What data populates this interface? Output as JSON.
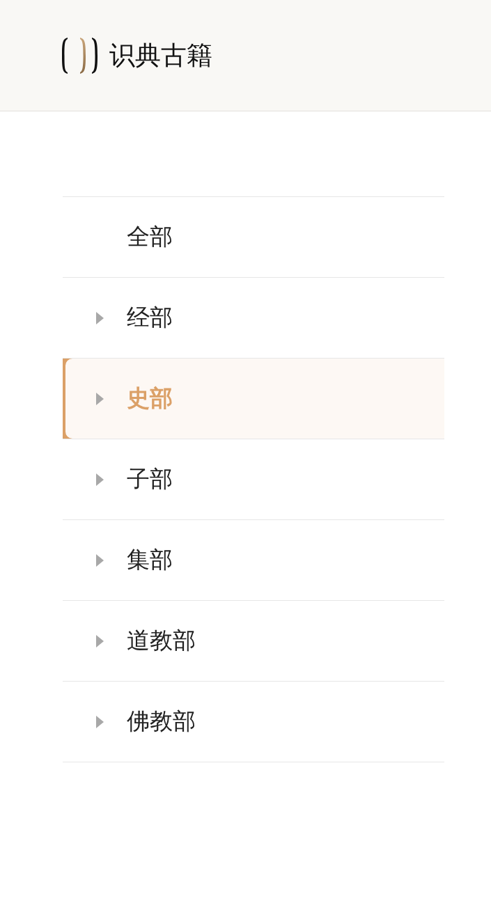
{
  "header": {
    "title": "识典古籍"
  },
  "categories": [
    {
      "label": "全部",
      "expandable": false,
      "selected": false
    },
    {
      "label": "经部",
      "expandable": true,
      "selected": false
    },
    {
      "label": "史部",
      "expandable": true,
      "selected": true
    },
    {
      "label": "子部",
      "expandable": true,
      "selected": false
    },
    {
      "label": "集部",
      "expandable": true,
      "selected": false
    },
    {
      "label": "道教部",
      "expandable": true,
      "selected": false
    },
    {
      "label": "佛教部",
      "expandable": true,
      "selected": false
    }
  ]
}
